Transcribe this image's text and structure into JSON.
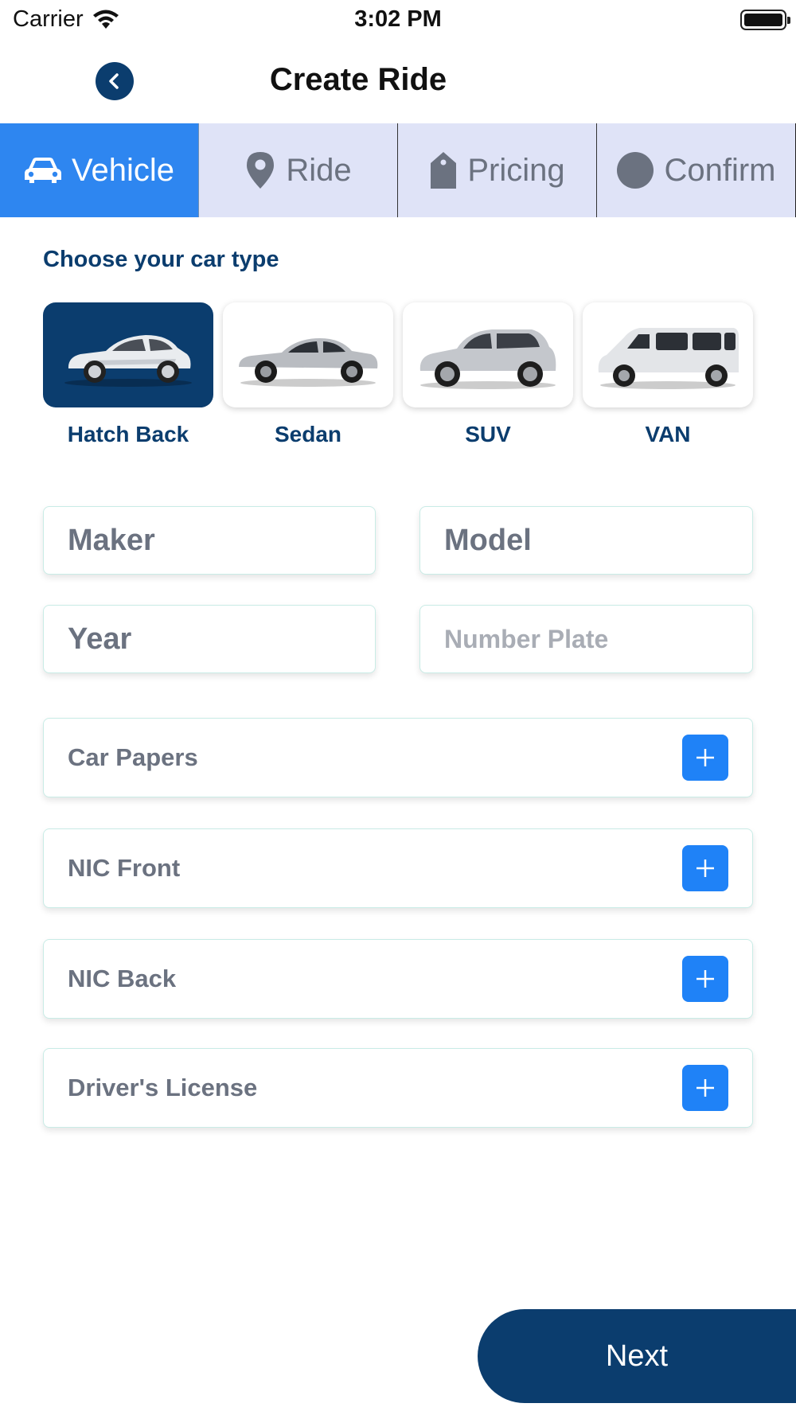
{
  "status_bar": {
    "carrier": "Carrier",
    "time": "3:02 PM"
  },
  "nav": {
    "title": "Create Ride"
  },
  "steps": [
    {
      "label": "Vehicle",
      "icon": "car-icon",
      "active": true
    },
    {
      "label": "Ride",
      "icon": "location-pin-icon",
      "active": false
    },
    {
      "label": "Pricing",
      "icon": "price-tag-icon",
      "active": false
    },
    {
      "label": "Confirm",
      "icon": "circle-icon",
      "active": false
    }
  ],
  "car_section": {
    "title": "Choose your car type",
    "types": [
      {
        "label": "Hatch Back",
        "icon": "hatchback-car-icon",
        "selected": true
      },
      {
        "label": "Sedan",
        "icon": "sedan-car-icon",
        "selected": false
      },
      {
        "label": "SUV",
        "icon": "suv-car-icon",
        "selected": false
      },
      {
        "label": "VAN",
        "icon": "van-icon",
        "selected": false
      }
    ]
  },
  "form": {
    "maker_placeholder": "Maker",
    "model_placeholder": "Model",
    "year_placeholder": "Year",
    "plate_placeholder": "Number Plate"
  },
  "uploads": [
    {
      "label": "Car Papers"
    },
    {
      "label": "NIC Front"
    },
    {
      "label": "NIC Back"
    },
    {
      "label": "Driver's License"
    }
  ],
  "next_label": "Next",
  "colors": {
    "primary_dark": "#0b3d6e",
    "accent_blue": "#2e86f0",
    "tab_inactive_bg": "#dfe3f7",
    "plus_button": "#1f82f7"
  }
}
